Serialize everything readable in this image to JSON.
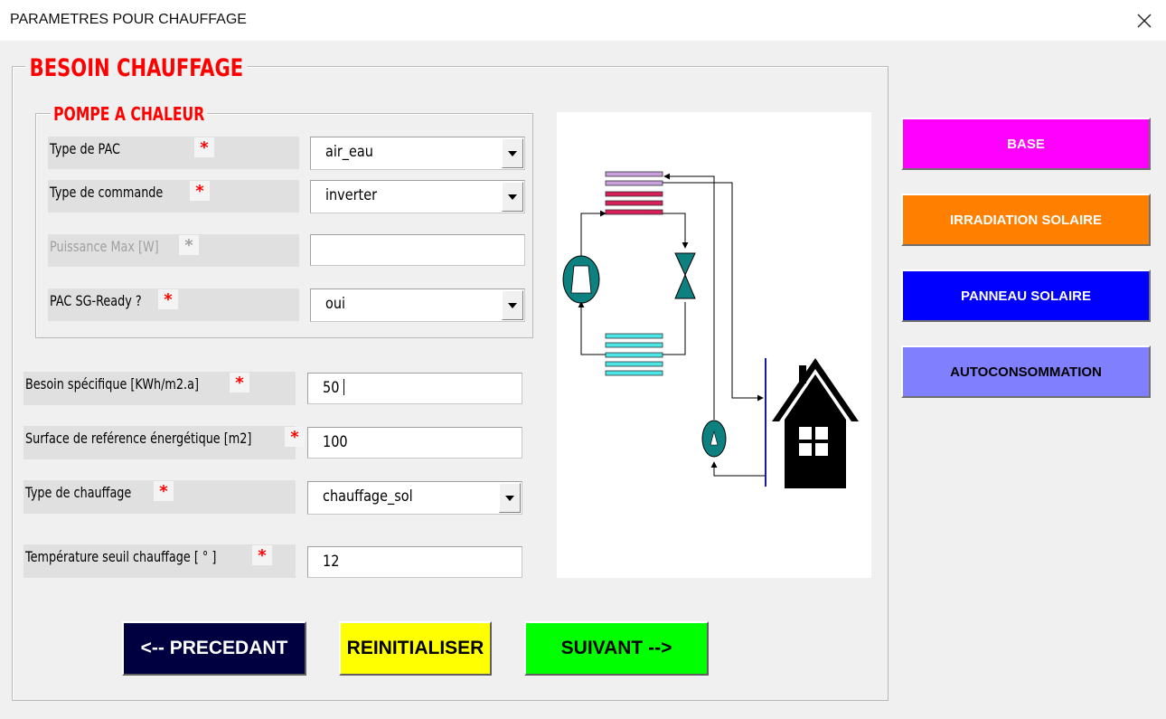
{
  "window": {
    "title": "PARAMETRES POUR CHAUFFAGE"
  },
  "icons": {
    "close": "close-icon",
    "dropdown": "chevron-down-icon"
  },
  "colors": {
    "legend_red": "#ff0000",
    "base": "#ff00ff",
    "irradiation": "#ff8000",
    "panneau": "#0000ff",
    "autoconsommation": "#8080ff",
    "precedant": "#000040",
    "reinitialiser": "#ffff00",
    "suivant": "#00ff00"
  },
  "besoin": {
    "legend": "BESOIN CHAUFFAGE",
    "pac": {
      "legend": "POMPE A CHALEUR",
      "type_pac": {
        "label": "Type de PAC",
        "star": "*",
        "value": "air_eau"
      },
      "type_commande": {
        "label": "Type de commande",
        "star": "*",
        "value": "inverter"
      },
      "puissance_max": {
        "label": "Puissance Max [W]",
        "star": "*",
        "value": ""
      },
      "sg_ready": {
        "label": "PAC SG-Ready ?",
        "star": "*",
        "value": "oui"
      }
    },
    "besoin_specifique": {
      "label": "Besoin spécifique [KWh/m2.a]",
      "star": "*",
      "value": "50"
    },
    "surface": {
      "label": "Surface de reférence énergétique [m2]",
      "star": "*",
      "value": "100"
    },
    "type_chauffage": {
      "label": "Type de chauffage",
      "star": "*",
      "value": "chauffage_sol"
    },
    "temperature": {
      "label": "Température seuil chauffage [ ° ]",
      "star": "*",
      "value": "12"
    }
  },
  "side_buttons": {
    "base": "BASE",
    "irradiation": "IRRADIATION SOLAIRE",
    "panneau": "PANNEAU SOLAIRE",
    "autoconsommation": "AUTOCONSOMMATION"
  },
  "nav": {
    "precedant": "<-- PRECEDANT",
    "reinitialiser": "REINITIALISER",
    "suivant": "SUIVANT -->"
  }
}
